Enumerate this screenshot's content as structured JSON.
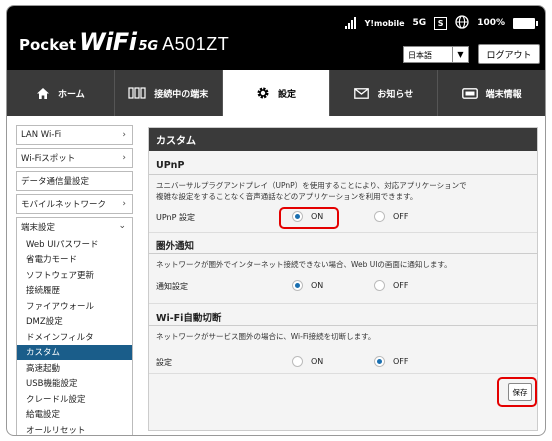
{
  "brand": {
    "pocket": "Pocket",
    "wifi": "WiFi",
    "g5": "5G",
    "model": "A501ZT"
  },
  "status": {
    "carrier": "Y!mobile",
    "network": "5G",
    "sim": "S",
    "battery": "100%"
  },
  "language": {
    "value": "日本語"
  },
  "logout_label": "ログアウト",
  "nav": {
    "tabs": [
      {
        "label": "ホーム",
        "icon": "home-icon"
      },
      {
        "label": "接続中の端末",
        "icon": "devices-icon"
      },
      {
        "label": "設定",
        "icon": "gear-icon",
        "active": true
      },
      {
        "label": "お知らせ",
        "icon": "mail-icon"
      },
      {
        "label": "端末情報",
        "icon": "device-info-icon"
      }
    ]
  },
  "sidebar": {
    "items": [
      {
        "label": "LAN Wi-Fi"
      },
      {
        "label": "Wi-Fiスポット"
      },
      {
        "label": "データ通信量設定"
      },
      {
        "label": "モバイルネットワーク"
      }
    ],
    "group_title": "端末設定",
    "subitems": [
      {
        "label": "Web UIパスワード"
      },
      {
        "label": "省電力モード"
      },
      {
        "label": "ソフトウェア更新"
      },
      {
        "label": "接続履歴"
      },
      {
        "label": "ファイアウォール"
      },
      {
        "label": "DMZ設定"
      },
      {
        "label": "ドメインフィルタ"
      },
      {
        "label": "カスタム",
        "active": true
      },
      {
        "label": "高速起動"
      },
      {
        "label": "USB機能設定"
      },
      {
        "label": "クレードル設定"
      },
      {
        "label": "給電設定"
      },
      {
        "label": "オールリセット"
      }
    ]
  },
  "main": {
    "title": "カスタム",
    "upnp": {
      "heading": "UPnP",
      "desc1": "ユニバーサルプラグアンドプレイ（UPnP）を使用することにより、対応アプリケーションで",
      "desc2": "複雑な設定をすることなく音声通話などのアプリケーションを利用できます。",
      "label": "UPnP 設定",
      "on": "ON",
      "off": "OFF",
      "value": "ON"
    },
    "outofarea": {
      "heading": "圏外通知",
      "desc": "ネットワークが圏外でインターネット接続できない場合、Web UIの画面に通知します。",
      "label": "通知設定",
      "on": "ON",
      "off": "OFF",
      "value": "ON"
    },
    "autodisconnect": {
      "heading": "Wi-Fi自動切断",
      "desc": "ネットワークがサービス圏外の場合に、Wi-Fi接続を切断します。",
      "label": "設定",
      "on": "ON",
      "off": "OFF",
      "value": "OFF"
    },
    "save_label": "保存"
  },
  "colors": {
    "header": "#000000",
    "nav": "#3a3a3a",
    "accent": "#1a6fb0",
    "highlight": "#e40000"
  }
}
